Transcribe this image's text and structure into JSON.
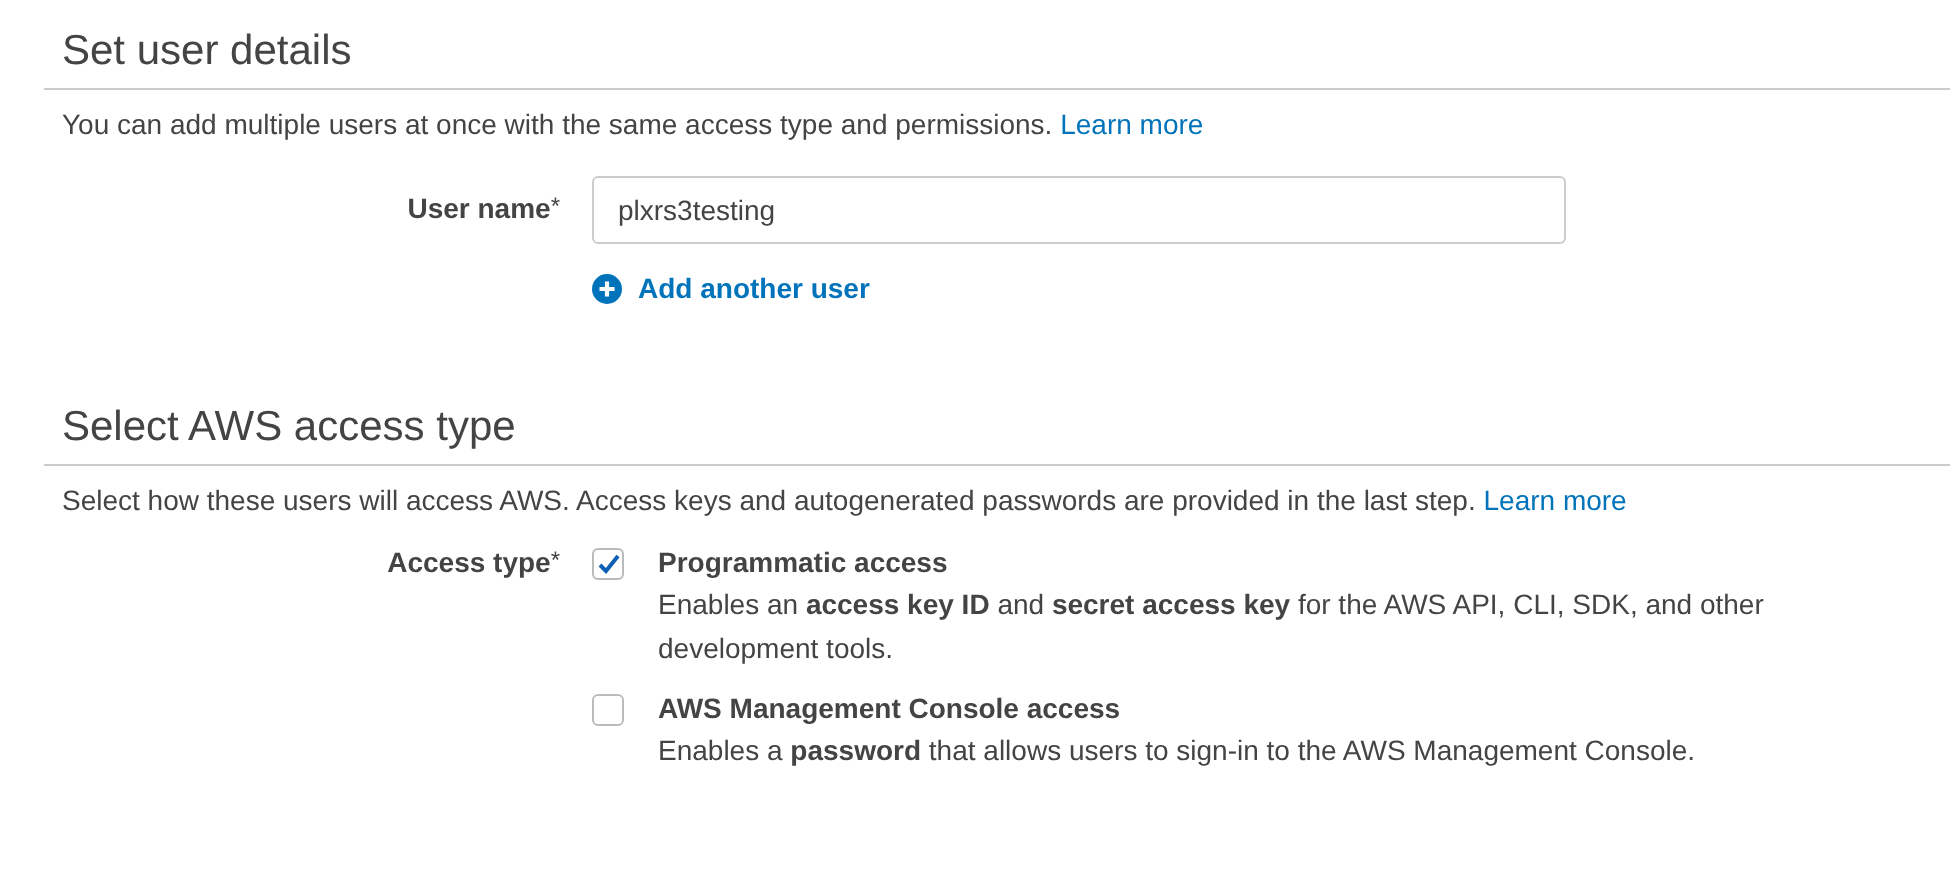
{
  "sections": [
    {
      "title": "Set user details",
      "description": "You can add multiple users at once with the same access type and permissions.",
      "link": "Learn more",
      "kind": "user",
      "field": {
        "label": "User name",
        "required_mark": "*",
        "value": "plxrs3testing"
      },
      "add_link": "Add another user"
    },
    {
      "title": "Select AWS access type",
      "description": "Select how these users will access AWS. Access keys and autogenerated passwords are provided in the last step.",
      "link": "Learn more",
      "kind": "access",
      "field": {
        "label": "Access type",
        "required_mark": "*"
      },
      "options": [
        {
          "label": "Programmatic access",
          "checked": true,
          "description": "Enables an **access key ID** and **secret access key** for the AWS API, CLI, SDK, and other development tools."
        },
        {
          "label": "AWS Management Console access",
          "checked": false,
          "description": "Enables a **password** that allows users to sign-in to the AWS Management Console."
        }
      ]
    }
  ]
}
